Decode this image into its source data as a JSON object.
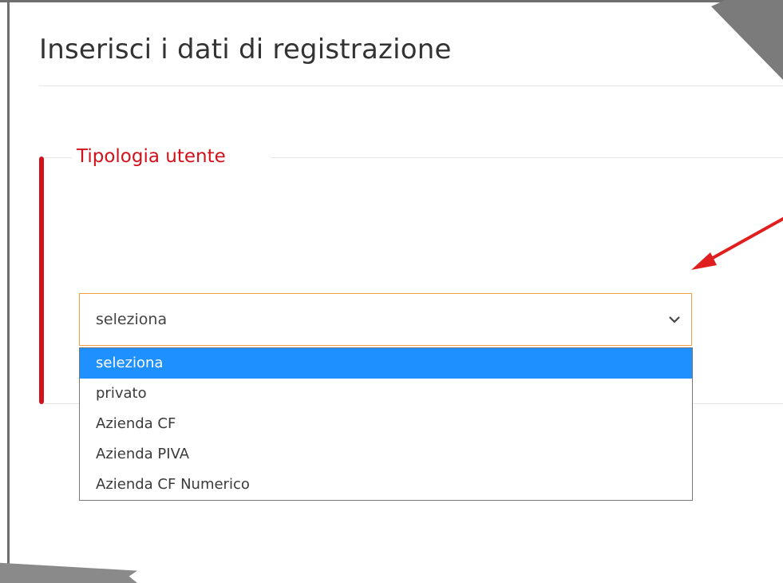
{
  "page": {
    "title": "Inserisci i dati di registrazione"
  },
  "section": {
    "legend": "Tipologia utente"
  },
  "select": {
    "current_value": "seleziona",
    "options": [
      "seleziona",
      "privato",
      "Azienda CF",
      "Azienda PIVA",
      "Azienda CF Numerico"
    ],
    "highlighted_index": 0
  },
  "colors": {
    "accent_red": "#d1111c",
    "focus_border": "#f0a23a",
    "highlight_blue": "#1e90ff",
    "annotation_arrow": "#e01e1e"
  },
  "icons": {
    "select_chevron": "chevron-down-icon",
    "annotation": "red-arrow-icon"
  }
}
